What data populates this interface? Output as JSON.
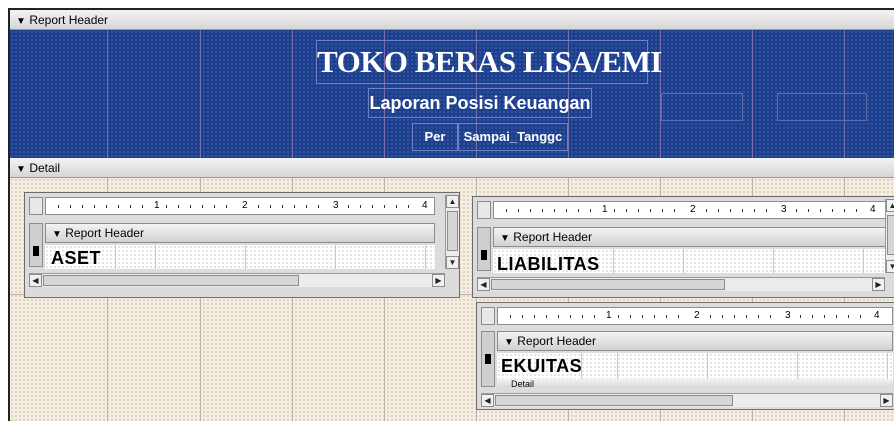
{
  "report_header": {
    "bar_label": "Report Header",
    "title": "TOKO BERAS LISA/EMI",
    "subtitle": "Laporan Posisi Keuangan",
    "per_label": "Per",
    "date_field": "Sampai_Tanggc"
  },
  "detail": {
    "bar_label": "Detail"
  },
  "subreports": [
    {
      "ruler_numbers": [
        "1",
        "2",
        "3",
        "4"
      ],
      "header_label": "Report Header",
      "content_label": "ASET"
    },
    {
      "ruler_numbers": [
        "1",
        "2",
        "3",
        "4"
      ],
      "header_label": "Report Header",
      "content_label": "LIABILITAS"
    },
    {
      "ruler_numbers": [
        "1",
        "2",
        "3",
        "4"
      ],
      "header_label": "Report Header",
      "content_label": "EKUITAS",
      "next_section_label": "Detail"
    }
  ],
  "colors": {
    "header_band": "#1c3f8f",
    "design_grid": "#f4ede0",
    "section_bar": "#d6d6d6"
  },
  "icons": {
    "section_marker": "section-marker-icon",
    "scroll_up": "scroll-up-icon",
    "scroll_down": "scroll-down-icon",
    "scroll_left": "scroll-left-icon",
    "scroll_right": "scroll-right-icon"
  }
}
